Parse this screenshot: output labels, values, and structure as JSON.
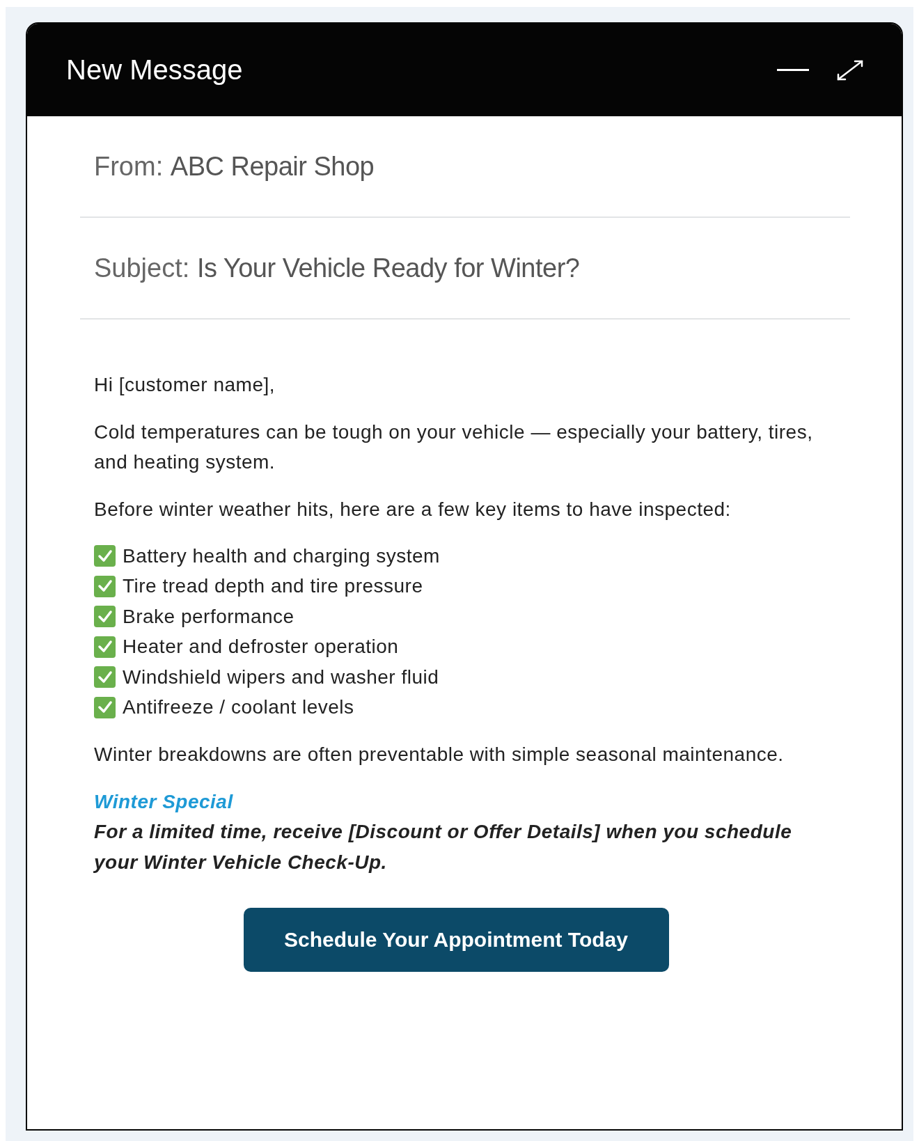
{
  "window": {
    "title": "New Message"
  },
  "fields": [
    {
      "label": "From:",
      "value": "ABC Repair Shop"
    },
    {
      "label": "Subject:",
      "value": "Is Your Vehicle Ready for Winter?"
    }
  ],
  "body": {
    "greeting": "Hi [customer name],",
    "intro": "Cold temperatures can be tough on your vehicle — especially your battery, tires, and heating system.",
    "lead": "Before winter weather hits, here are a few key items to have inspected:",
    "checklist": [
      {
        "text": "Battery health and charging system",
        "checked": true
      },
      {
        "text": "Tire tread depth and tire pressure",
        "checked": true
      },
      {
        "text": "Brake performance",
        "checked": true
      },
      {
        "text": "Heater and defroster operation",
        "checked": true
      },
      {
        "text": "Windshield wipers and washer fluid",
        "checked": true
      },
      {
        "text": "Antifreeze / coolant levels",
        "checked": true
      }
    ],
    "closing": "Winter breakdowns are often preventable with simple seasonal maintenance.",
    "special_title": "Winter Special",
    "special_text": "For a limited time, receive [Discount or Offer Details] when you schedule your Winter Vehicle Check-Up."
  },
  "button": "Schedule Your Appointment Today"
}
